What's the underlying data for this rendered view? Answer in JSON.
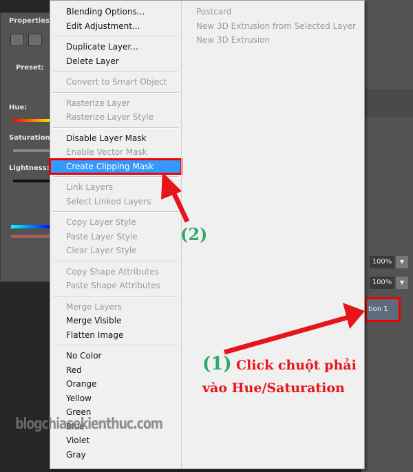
{
  "properties_panel": {
    "title": "Properties",
    "preset_label": "Preset:",
    "hue_label": "Hue:",
    "saturation_label": "Saturation:",
    "lightness_label": "Lightness:"
  },
  "layers_panel": {
    "opacity": "100%",
    "fill": "100%",
    "layer_name": "tion 1"
  },
  "context_menu": {
    "groups": [
      [
        {
          "label": "Blending Options...",
          "enabled": true
        },
        {
          "label": "Edit Adjustment...",
          "enabled": true
        }
      ],
      [
        {
          "label": "Duplicate Layer...",
          "enabled": true
        },
        {
          "label": "Delete Layer",
          "enabled": true
        }
      ],
      [
        {
          "label": "Convert to Smart Object",
          "enabled": false
        }
      ],
      [
        {
          "label": "Rasterize Layer",
          "enabled": false
        },
        {
          "label": "Rasterize Layer Style",
          "enabled": false
        }
      ],
      [
        {
          "label": "Disable Layer Mask",
          "enabled": true
        },
        {
          "label": "Enable Vector Mask",
          "enabled": false
        },
        {
          "label": "Create Clipping Mask",
          "enabled": true,
          "highlighted": true
        }
      ],
      [
        {
          "label": "Link Layers",
          "enabled": false
        },
        {
          "label": "Select Linked Layers",
          "enabled": false
        }
      ],
      [
        {
          "label": "Copy Layer Style",
          "enabled": false
        },
        {
          "label": "Paste Layer Style",
          "enabled": false
        },
        {
          "label": "Clear Layer Style",
          "enabled": false
        }
      ],
      [
        {
          "label": "Copy Shape Attributes",
          "enabled": false
        },
        {
          "label": "Paste Shape Attributes",
          "enabled": false
        }
      ],
      [
        {
          "label": "Merge Layers",
          "enabled": false
        },
        {
          "label": "Merge Visible",
          "enabled": true
        },
        {
          "label": "Flatten Image",
          "enabled": true
        }
      ],
      [
        {
          "label": "No Color",
          "enabled": true
        },
        {
          "label": "Red",
          "enabled": true
        },
        {
          "label": "Orange",
          "enabled": true
        },
        {
          "label": "Yellow",
          "enabled": true
        },
        {
          "label": "Green",
          "enabled": true
        },
        {
          "label": "Blue",
          "enabled": true
        },
        {
          "label": "Violet",
          "enabled": true
        },
        {
          "label": "Gray",
          "enabled": true
        }
      ]
    ],
    "right_column": [
      {
        "label": "Postcard",
        "enabled": false
      },
      {
        "label": "New 3D Extrusion from Selected Layer",
        "enabled": false
      },
      {
        "label": "New 3D Extrusion",
        "enabled": false
      }
    ]
  },
  "annotations": {
    "step2": "(2)",
    "step1_num": "(1)",
    "step1_line1": "Click chuột phải",
    "step1_line2": "vào Hue/Saturation"
  },
  "watermark": "blogchiasekienthuc.com",
  "colors": {
    "highlight": "#3399ff",
    "annotation_red": "#e8141b",
    "annotation_green": "#2fa86a"
  }
}
